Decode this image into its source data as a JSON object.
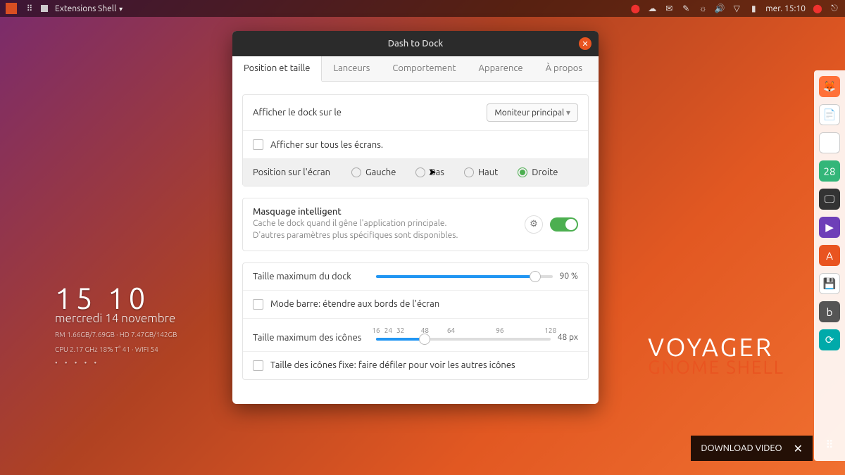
{
  "topbar": {
    "app_label": "Extensions Shell",
    "clock": "mer. 15:10"
  },
  "desktop": {
    "clock_time": "15 10",
    "clock_date": "mercredi 14 novembre",
    "sys_line1": "RM 1.66GB/7.69GB · HD 7.47GB/142GB",
    "sys_line2": "CPU 2.17 GHz 18% T° 41 · WIFI 54",
    "pager": "• • • • •",
    "brand_line1": "VOYAGER",
    "brand_line2": "GNOME SHELL"
  },
  "dialog": {
    "title": "Dash to Dock",
    "tabs": [
      "Position et taille",
      "Lanceurs",
      "Comportement",
      "Apparence",
      "À propos"
    ],
    "monitor": {
      "label": "Afficher le dock sur le",
      "selected": "Moniteur principal",
      "check_all": "Afficher sur tous les écrans."
    },
    "position": {
      "label": "Position sur l'écran",
      "options": [
        "Gauche",
        "Bas",
        "Haut",
        "Droite"
      ],
      "selected": "Droite"
    },
    "autohide": {
      "title": "Masquage intelligent",
      "desc": "Cache le dock quand il gêne l'application principale. D'autres paramètres plus spécifiques sont disponibles."
    },
    "dock_size": {
      "label": "Taille maximum du dock",
      "value": 90,
      "display": "90 %",
      "check_extend": "Mode barre: étendre aux bords de l'écran"
    },
    "icon_size": {
      "label": "Taille maximum des icônes",
      "ticks": [
        "16",
        "24",
        "32",
        "48",
        "64",
        "96",
        "128"
      ],
      "value": 48,
      "display": "48 px",
      "check_fixed": "Taille des icônes fixe: faire défiler pour voir les autres icônes"
    }
  },
  "dock_icons": {
    "calendar_day": "28"
  },
  "overlay": {
    "download": "DOWNLOAD VIDEO"
  }
}
